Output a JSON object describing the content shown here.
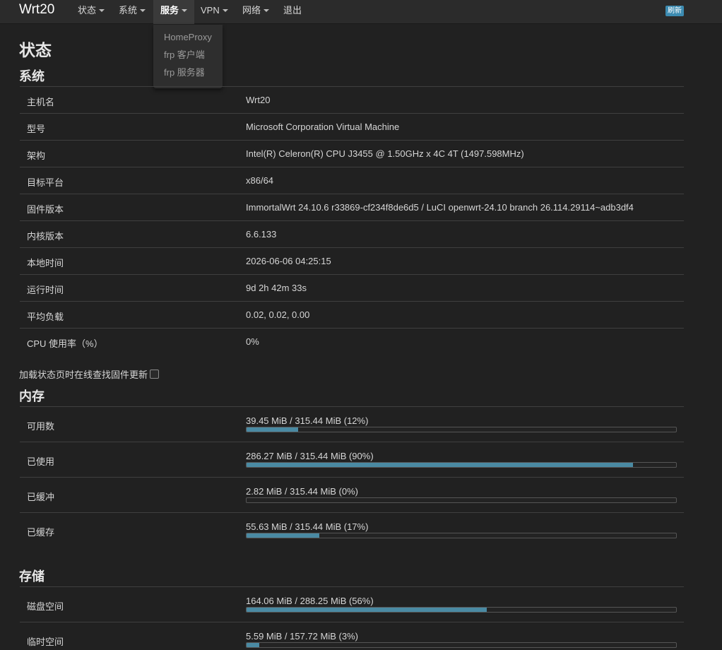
{
  "nav": {
    "brand": "Wrt20",
    "items": [
      "状态",
      "系统",
      "服务",
      "VPN",
      "网络",
      "退出"
    ],
    "refresh": "刷新"
  },
  "dropdown": {
    "items": [
      "HomeProxy",
      "frp 客户端",
      "frp 服务器"
    ]
  },
  "page": {
    "title": "状态"
  },
  "system": {
    "title": "系统",
    "rows": [
      {
        "k": "主机名",
        "v": "Wrt20"
      },
      {
        "k": "型号",
        "v": "Microsoft Corporation Virtual Machine"
      },
      {
        "k": "架构",
        "v": "Intel(R) Celeron(R) CPU J3455 @ 1.50GHz x 4C 4T (1497.598MHz)"
      },
      {
        "k": "目标平台",
        "v": "x86/64"
      },
      {
        "k": "固件版本",
        "v": "ImmortalWrt 24.10.6 r33869-cf234f8de6d5 / LuCI openwrt-24.10 branch 26.114.29114~adb3df4"
      },
      {
        "k": "内核版本",
        "v": "6.6.133"
      },
      {
        "k": "本地时间",
        "v": "2026-06-06 04:25:15"
      },
      {
        "k": "运行时间",
        "v": "9d 2h 42m 33s"
      },
      {
        "k": "平均负载",
        "v": "0.02, 0.02, 0.00"
      },
      {
        "k": "CPU 使用率（%）",
        "v": "0%"
      }
    ]
  },
  "update_check": {
    "label": "加载状态页时在线查找固件更新"
  },
  "memory": {
    "title": "内存",
    "rows": [
      {
        "k": "可用数",
        "v": "39.45 MiB / 315.44 MiB (12%)",
        "pct": 12
      },
      {
        "k": "已使用",
        "v": "286.27 MiB / 315.44 MiB (90%)",
        "pct": 90
      },
      {
        "k": "已缓冲",
        "v": "2.82 MiB / 315.44 MiB (0%)",
        "pct": 0
      },
      {
        "k": "已缓存",
        "v": "55.63 MiB / 315.44 MiB (17%)",
        "pct": 17
      }
    ]
  },
  "storage": {
    "title": "存储",
    "rows": [
      {
        "k": "磁盘空间",
        "v": "164.06 MiB / 288.25 MiB (56%)",
        "pct": 56
      },
      {
        "k": "临时空间",
        "v": "5.59 MiB / 157.72 MiB (3%)",
        "pct": 3
      }
    ]
  },
  "colors": {
    "background": "#212121",
    "navbar": "#2b2b2b",
    "accent": "#4a8aa3",
    "badge": "#3c8bb1"
  }
}
